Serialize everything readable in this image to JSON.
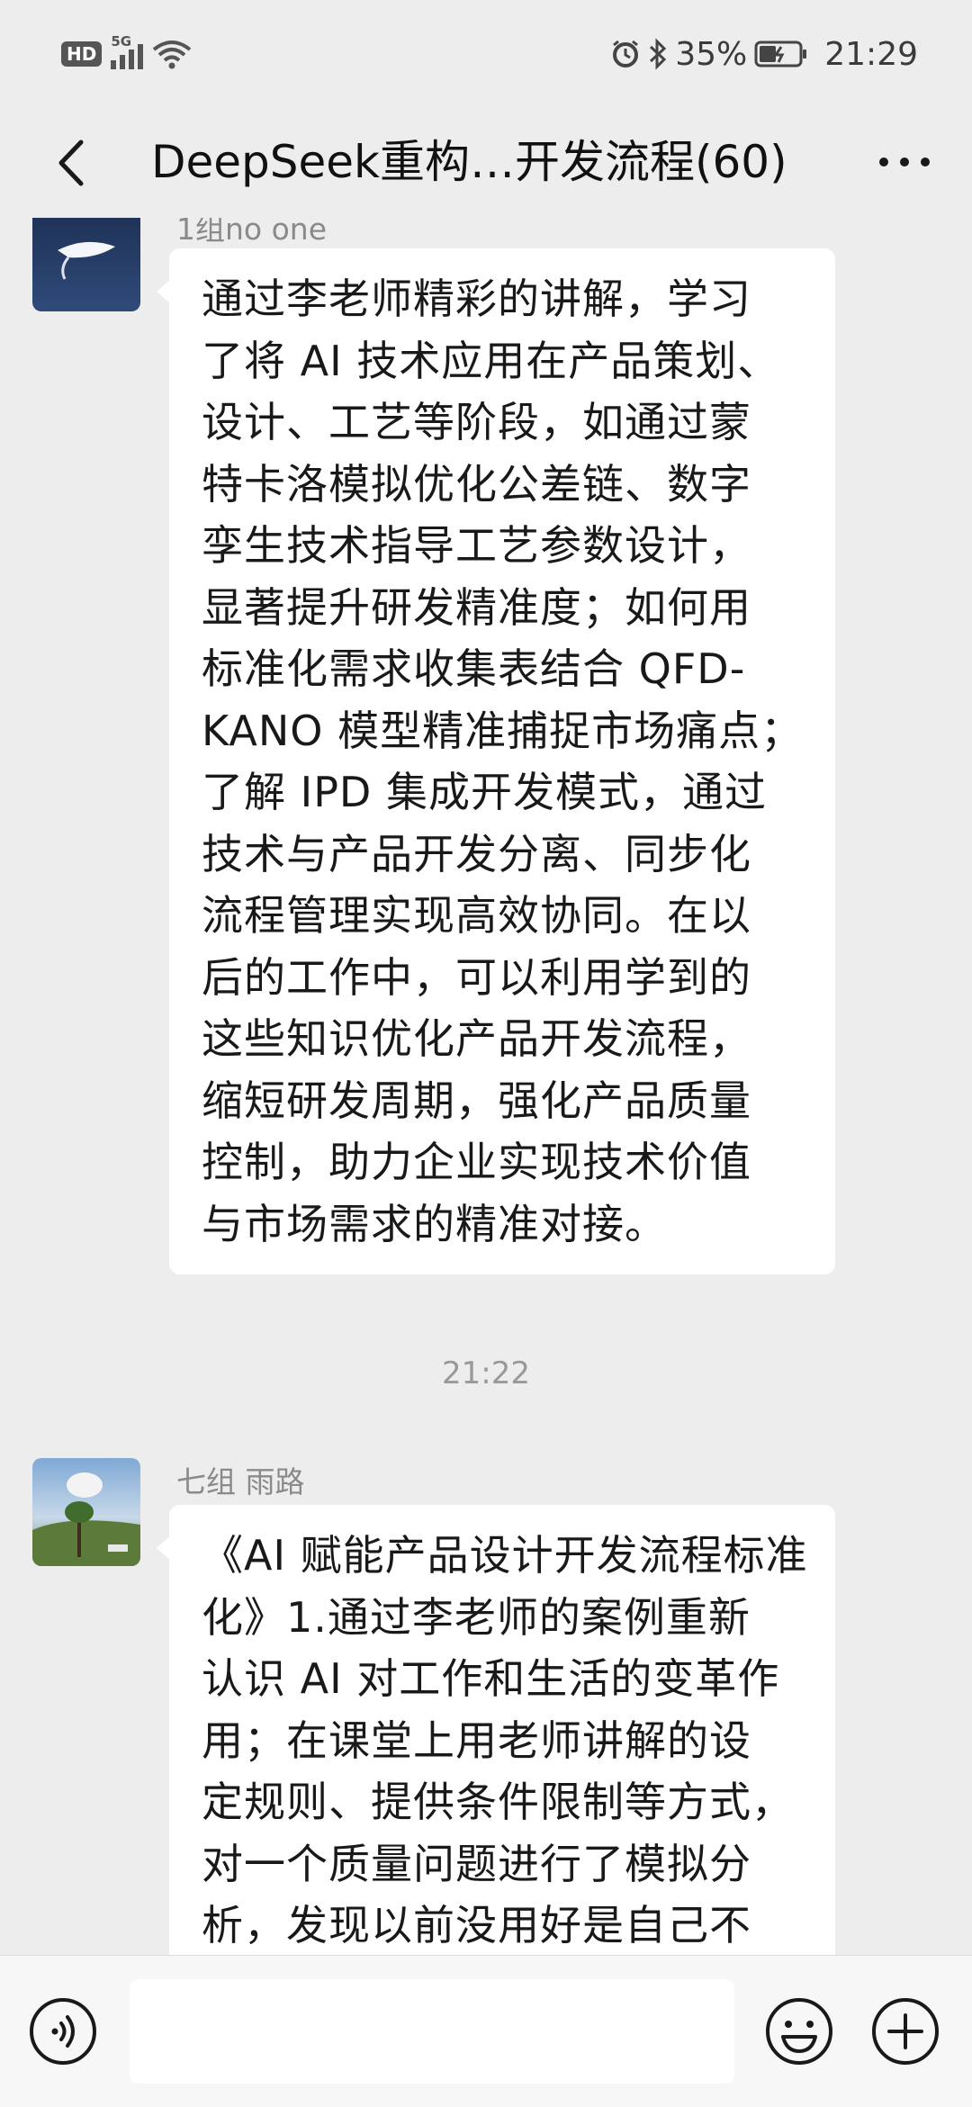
{
  "status_bar": {
    "hd": "HD",
    "network": "5G",
    "battery": "35%",
    "time": "21:29"
  },
  "header": {
    "title": "DeepSeek重构…开发流程(60)",
    "back_icon": "chevron-left-icon",
    "more_icon": "more-dots-icon"
  },
  "messages": [
    {
      "sender": "1组no one",
      "lines": [
        "通过李老师精彩的讲解，学习",
        "了将 AI 技术应用在产品策划、",
        "设计、工艺等阶段，如通过蒙",
        "特卡洛模拟优化公差链、数字",
        "孪生技术指导工艺参数设计，",
        "显著提升研发精准度；如何用",
        "标准化需求收集表结合 QFD-",
        "KANO 模型精准捕捉市场痛点；",
        "了解 IPD 集成开发模式，通过",
        "技术与产品开发分离、同步化",
        "流程管理实现高效协同。在以",
        "后的工作中，可以利用学到的",
        "这些知识优化产品开发流程，",
        "缩短研发周期，强化产品质量",
        "控制，助力企业实现技术价值",
        "与市场需求的精准对接。"
      ]
    },
    {
      "sender": "七组 雨路",
      "lines": [
        "《AI 赋能产品设计开发流程标准",
        "化》1.通过李老师的案例重新",
        "认识 AI 对工作和生活的变革作",
        "用；在课堂上用老师讲解的设",
        "定规则、提供条件限制等方式，",
        "对一个质量问题进行了模拟分",
        "析，发现以前没用好是自己不"
      ]
    }
  ],
  "timestamp": "21:22",
  "input_bar": {
    "text_value": "",
    "voice_icon": "voice-icon",
    "emoji_icon": "emoji-icon",
    "plus_icon": "plus-icon"
  }
}
